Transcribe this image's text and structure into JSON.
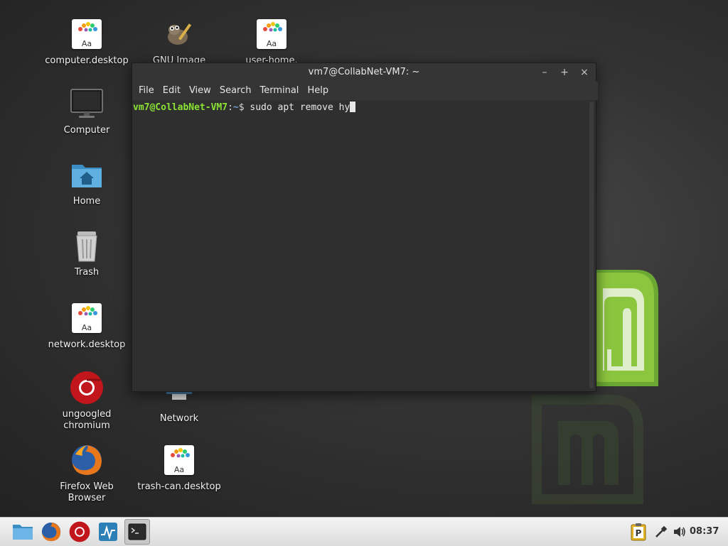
{
  "desktop": {
    "icons": [
      {
        "label": "computer.desktop"
      },
      {
        "label": "GNU Image"
      },
      {
        "label": "user-home."
      },
      {
        "label": "Computer"
      },
      {
        "label": "Home"
      },
      {
        "label": "Trash"
      },
      {
        "label": "network.desktop"
      },
      {
        "label": "ungoogled\nchromium"
      },
      {
        "label": "Network"
      },
      {
        "label": "Firefox Web\nBrowser"
      },
      {
        "label": "trash-can.desktop"
      }
    ],
    "font_doc_glyph_text": "Aa"
  },
  "terminal": {
    "title": "vm7@CollabNet-VM7: ~",
    "minimize_symbol": "–",
    "maximize_symbol": "+",
    "close_symbol": "×",
    "menu": [
      "File",
      "Edit",
      "View",
      "Search",
      "Terminal",
      "Help"
    ],
    "prompt_user": "vm7@CollabNet-VM7",
    "prompt_sep": ":",
    "prompt_path": "~",
    "prompt_symbol": "$ ",
    "command": "sudo apt remove hy"
  },
  "taskbar": {
    "clock": "08:37"
  },
  "colors": {
    "prompt_green": "#8ae234",
    "prompt_blue": "#729fcf",
    "mint_green": "#8cc63f"
  }
}
